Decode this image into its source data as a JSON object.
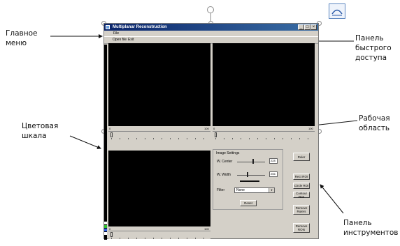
{
  "window": {
    "title": "Multiplanar Reconstruction",
    "buttons": [
      "_",
      "□",
      "×"
    ]
  },
  "menu": {
    "items": [
      {
        "label": "File"
      }
    ]
  },
  "toolbar": {
    "items": [
      {
        "label": "Open file"
      },
      {
        "label": "Exit"
      }
    ]
  },
  "viewports": [
    {
      "min": "0",
      "max": "100"
    },
    {
      "min": "0",
      "max": "100"
    },
    {
      "min": "0",
      "max": "100"
    }
  ],
  "image_settings": {
    "title": "Image Settings",
    "center_label": "W. Center",
    "center_value": "228",
    "width_label": "W. Width",
    "width_value": "256",
    "filter_label": "Filter",
    "filter_value": "None",
    "reset_label": "Reset"
  },
  "tool_buttons": [
    {
      "label": "Ruler"
    },
    {
      "label": "Rect ROI"
    },
    {
      "label": "Circle ROI"
    },
    {
      "label": "Contour ROI"
    },
    {
      "label": "Remove\nRulers"
    },
    {
      "label": "Remove\nROIs"
    }
  ],
  "annotations": {
    "main_menu": "Главное\nменю",
    "quick_access": "Панель\nбыстрого\nдоступа",
    "color_scale": "Цветовая\nшкала",
    "work_area": "Рабочая\nобласть",
    "tool_panel": "Панель\nинструментов"
  },
  "colors": {
    "titlebar": "#0a246a",
    "window_bg": "#d4d0c8",
    "viewport_bg": "#000000",
    "colorbar_swatches": [
      "#ffffff",
      "#30c030",
      "#3060e0",
      "#ffffff"
    ]
  },
  "icons": [
    "app-icon",
    "quick-access-icon",
    "selection-rotate-handle"
  ]
}
